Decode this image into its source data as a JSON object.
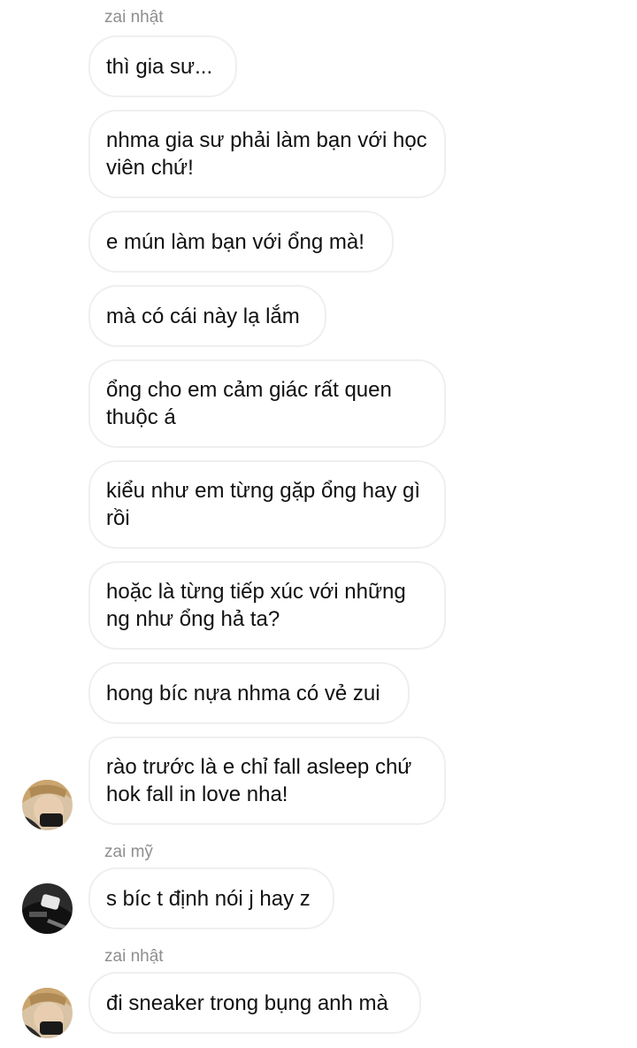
{
  "chat": {
    "sender_top": "zai nhật",
    "sender_my": "zai mỹ",
    "sender_bottom": "zai nhật",
    "messages": [
      "thì gia sư...",
      "nhma gia sư phải làm bạn với học viên chứ!",
      "e mún làm bạn với ổng mà!",
      "mà có cái này lạ lắm",
      "ổng cho em cảm giác rất quen thuộc á",
      "kiểu như em từng gặp ổng hay gì rồi",
      "hoặc là từng tiếp xúc với những ng như ổng hả ta?",
      "hong bíc nựa nhma có vẻ zui",
      "rào trước là e chỉ fall asleep chứ hok fall in love nha!",
      "s bíc t định nói j hay z",
      "đi sneaker trong bụng anh mà"
    ]
  }
}
